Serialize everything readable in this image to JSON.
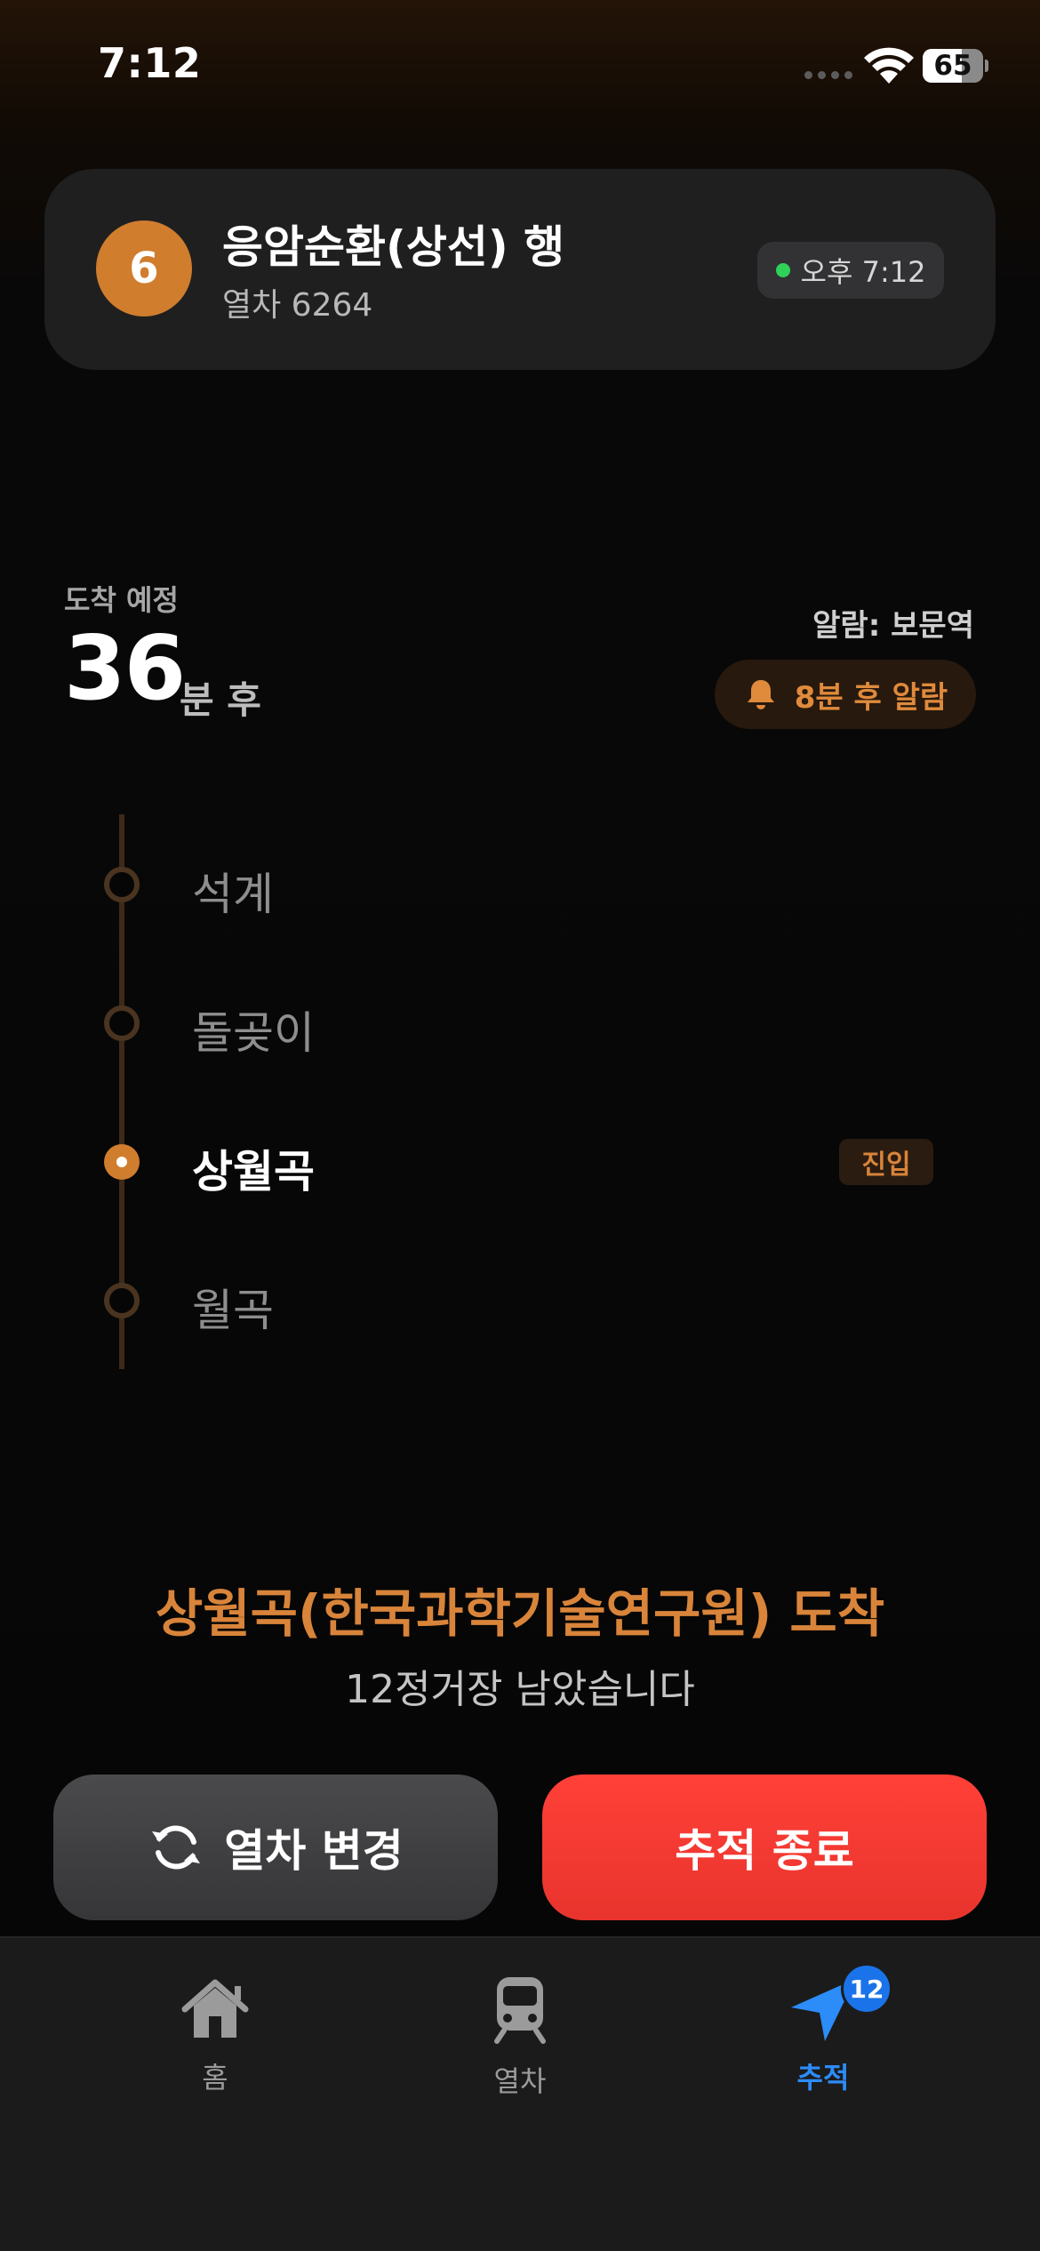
{
  "status_bar": {
    "time": "7:12",
    "battery_level": "65",
    "battery_fraction": 0.65,
    "wifi_icon": "wifi-icon"
  },
  "train_card": {
    "line_number": "6",
    "line_color": "#d07d2e",
    "destination": "응암순환(상선) 행",
    "train_number": "열차 6264",
    "updated_time": "오후 7:12",
    "live_color": "#2fd158"
  },
  "arrival": {
    "label": "도착 예정",
    "minutes": "36",
    "unit": "분 후",
    "alarm_station": "알람: 보문역",
    "alarm_text": "8분 후 알람",
    "alarm_icon": "bell-icon"
  },
  "stations": [
    {
      "name": "석계",
      "status": "passed"
    },
    {
      "name": "돌곶이",
      "status": "passed"
    },
    {
      "name": "상월곡",
      "status": "current",
      "badge": "진입"
    },
    {
      "name": "월곡",
      "status": "upcoming"
    }
  ],
  "destination_message": {
    "title": "상월곡(한국과학기술연구원) 도착",
    "subtitle": "12정거장 남았습니다"
  },
  "actions": {
    "change_train": "열차 변경",
    "change_icon": "refresh-icon",
    "stop_tracking": "추적 종료",
    "stop_color": "#ff3b30"
  },
  "tab_bar": {
    "tabs": [
      {
        "label": "홈",
        "icon": "home-icon",
        "active": false
      },
      {
        "label": "열차",
        "icon": "train-icon",
        "active": false
      },
      {
        "label": "추적",
        "icon": "location-arrow-icon",
        "active": true,
        "badge": "12"
      }
    ],
    "accent_color": "#2c8cf8"
  }
}
